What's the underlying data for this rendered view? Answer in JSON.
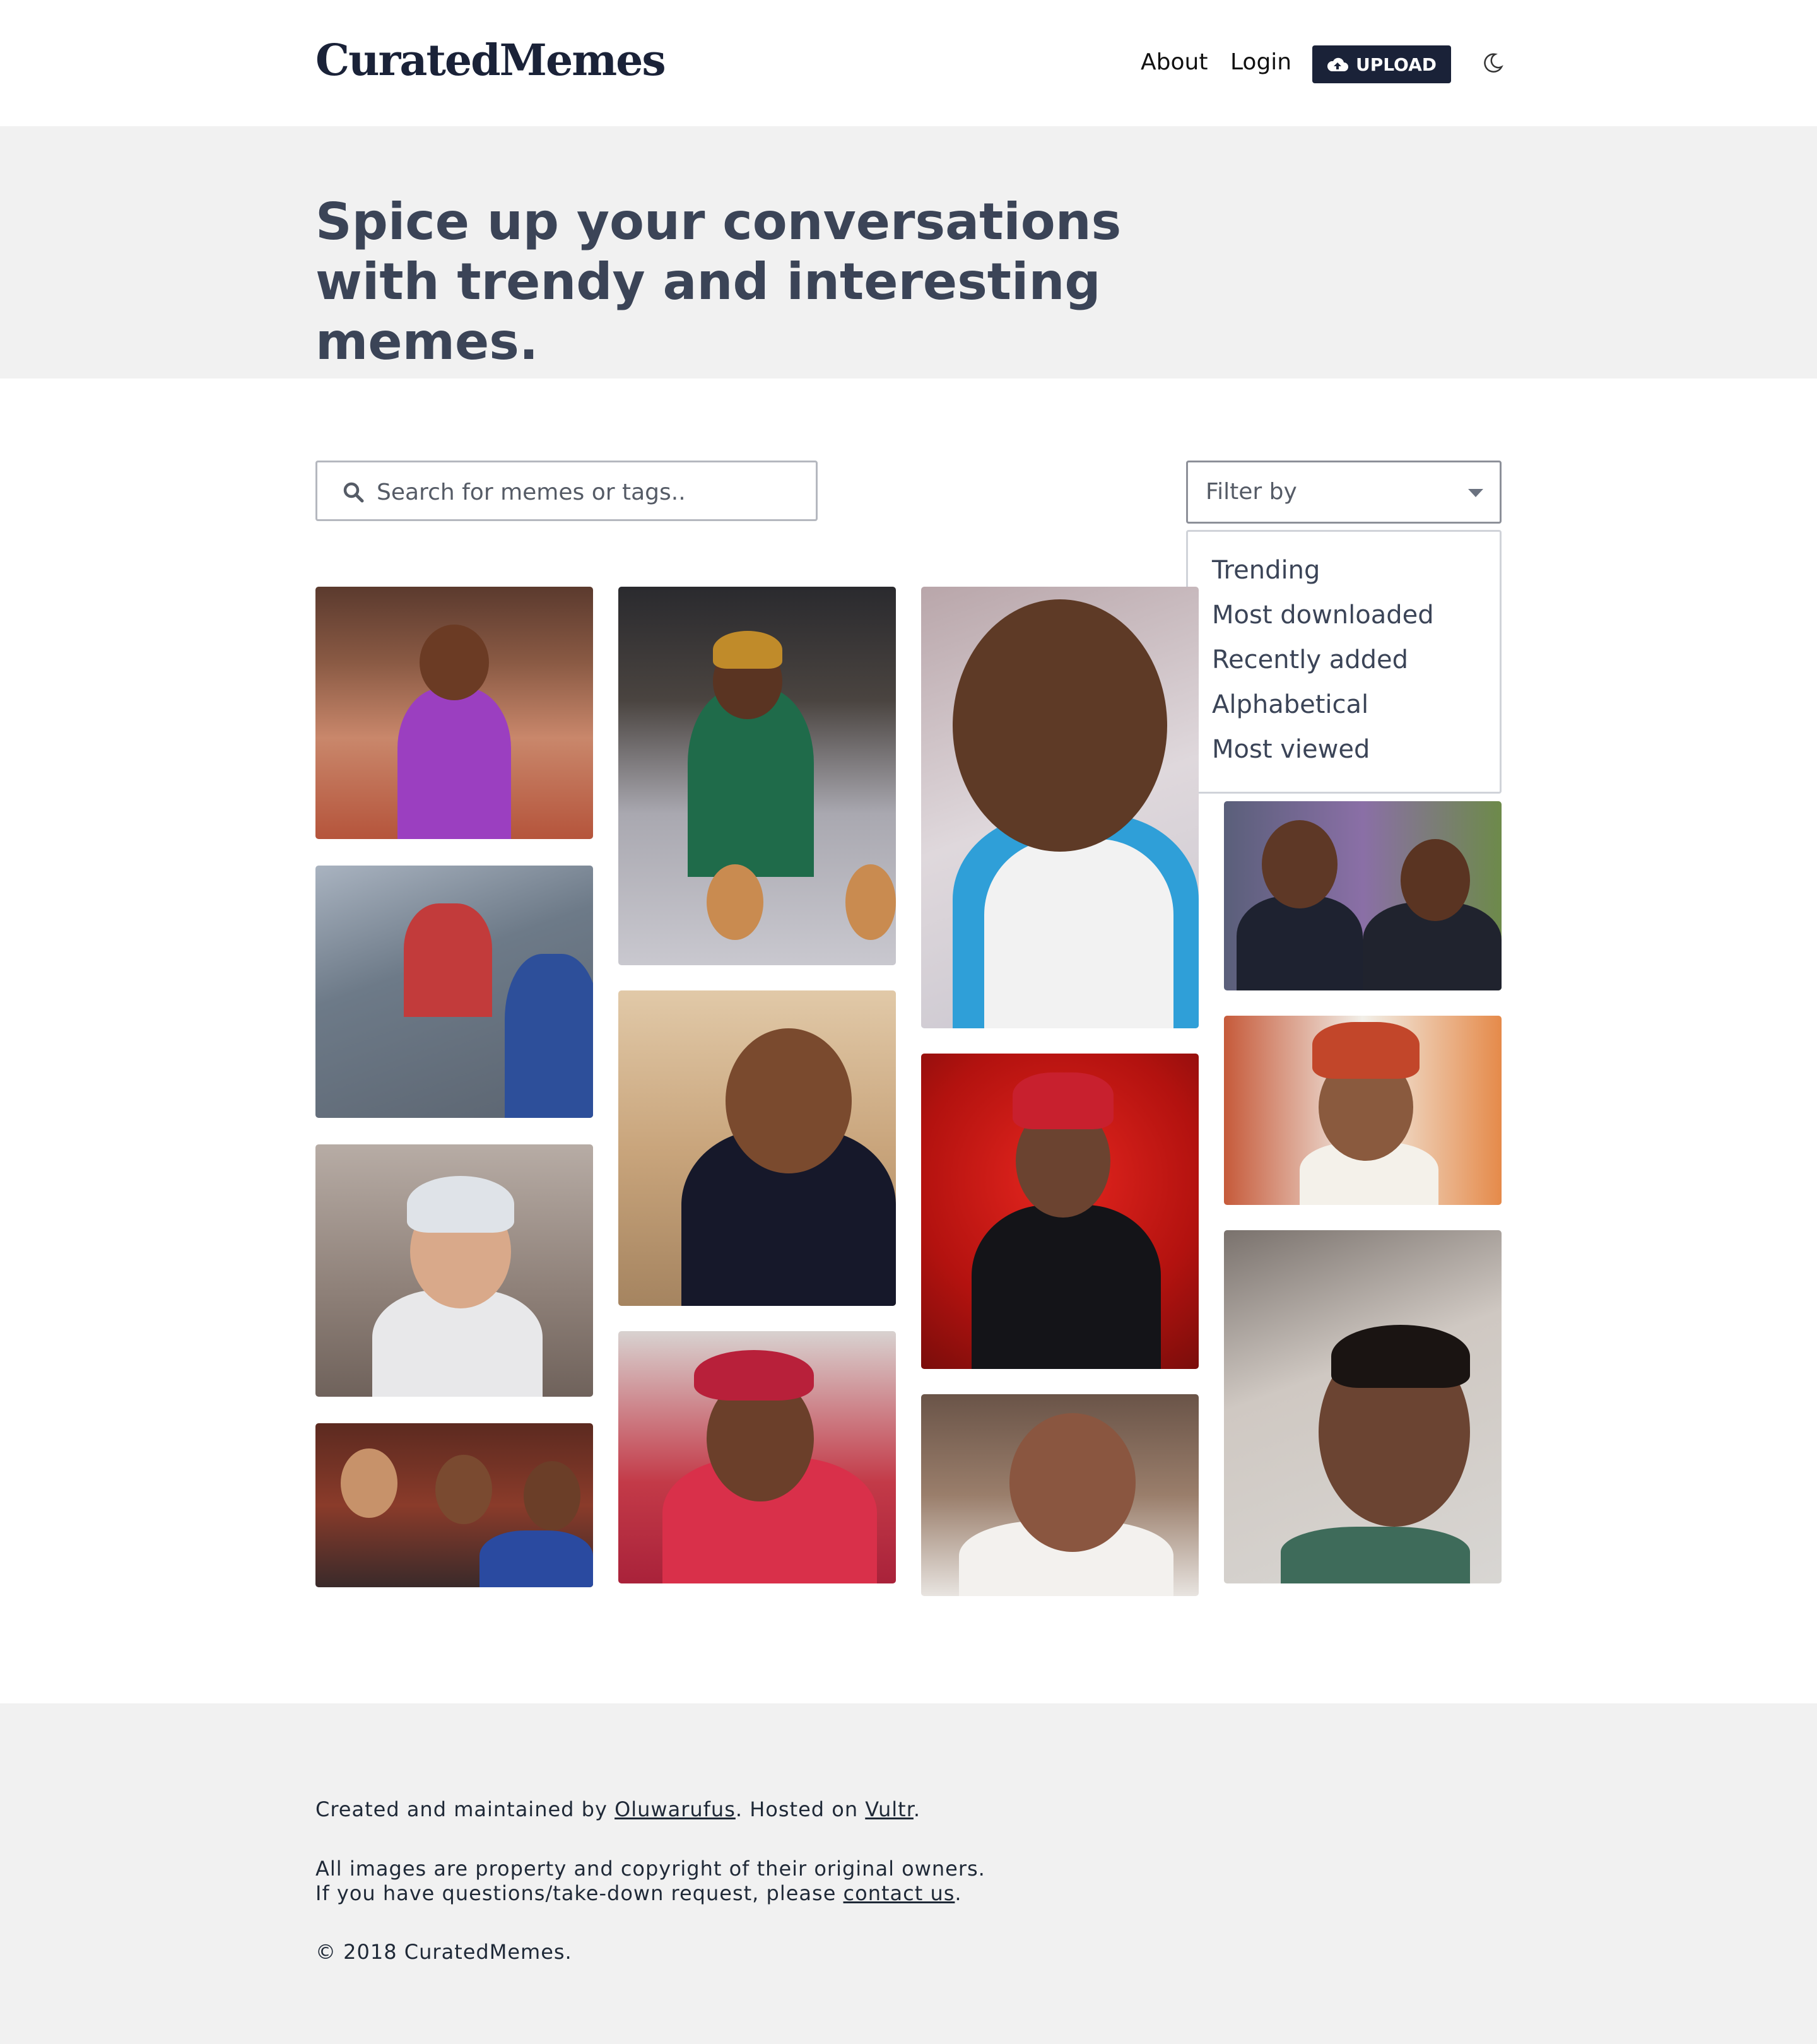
{
  "header": {
    "logo": "CuratedMemes",
    "nav_about": "About",
    "nav_login": "Login",
    "upload_label": "UPLOAD"
  },
  "hero": {
    "title": "Spice up your conversations with trendy and interesting memes."
  },
  "search": {
    "placeholder": "Search for memes or tags.."
  },
  "filter": {
    "label": "Filter by",
    "options": [
      "Trending",
      "Most downloaded",
      "Recently added",
      "Alphabetical",
      "Most viewed"
    ]
  },
  "footer": {
    "credit_prefix": "Created and maintained by ",
    "credit_author": "Oluwarufus",
    "credit_mid": ". Hosted on ",
    "credit_host": "Vultr",
    "credit_suffix": ".",
    "rights_line1": "All images are property and copyright of their original owners.",
    "rights_line2_prefix": "If you have questions/take-down request, please ",
    "rights_contact": "contact us",
    "rights_line2_suffix": ".",
    "copyright": "© 2018 CuratedMemes."
  },
  "colors": {
    "brand": "#1a2238",
    "hero_bg": "#f1f1f1",
    "hero_text": "#3b4457"
  }
}
